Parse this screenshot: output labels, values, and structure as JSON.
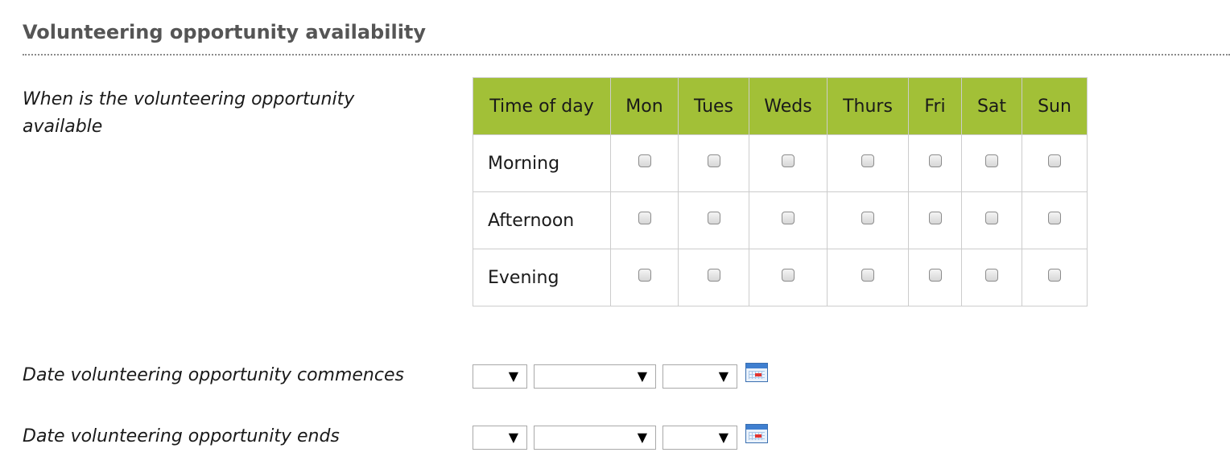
{
  "section": {
    "title": "Volunteering opportunity availability"
  },
  "availability": {
    "label": "When is the volunteering opportunity available",
    "headers": [
      "Time of day",
      "Mon",
      "Tues",
      "Weds",
      "Thurs",
      "Fri",
      "Sat",
      "Sun"
    ],
    "rows": [
      {
        "label": "Morning",
        "checked": [
          false,
          false,
          false,
          false,
          false,
          false,
          false
        ]
      },
      {
        "label": "Afternoon",
        "checked": [
          false,
          false,
          false,
          false,
          false,
          false,
          false
        ]
      },
      {
        "label": "Evening",
        "checked": [
          false,
          false,
          false,
          false,
          false,
          false,
          false
        ]
      }
    ]
  },
  "start_date": {
    "label": "Date volunteering opportunity commences",
    "day": "",
    "month": "",
    "year": "",
    "icon": "calendar-icon"
  },
  "end_date": {
    "label": "Date volunteering opportunity ends",
    "day": "",
    "month": "",
    "year": "",
    "icon": "calendar-icon"
  },
  "colors": {
    "header_bg": "#a2c037",
    "title": "#555555",
    "border": "#cccccc"
  }
}
